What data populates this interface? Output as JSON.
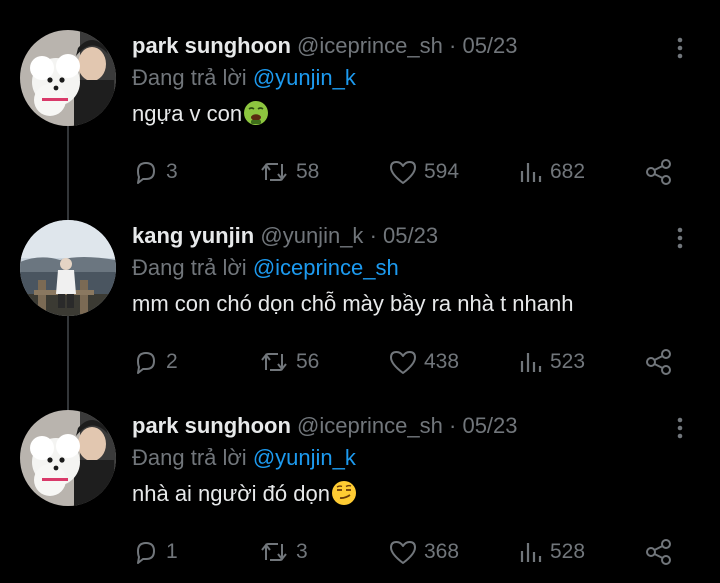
{
  "tweets": [
    {
      "name": "park sunghoon",
      "handle": "@iceprince_sh",
      "separator": "·",
      "date": "05/23",
      "reply_prefix": "Đang trả lời",
      "reply_to": "@yunjin_k",
      "text": "ngựa v con",
      "emoji": "nauseated-face",
      "replies": "3",
      "retweets": "58",
      "likes": "594",
      "views": "682"
    },
    {
      "name": "kang yunjin",
      "handle": "@yunjin_k",
      "separator": "·",
      "date": "05/23",
      "reply_prefix": "Đang trả lời",
      "reply_to": "@iceprince_sh",
      "text": "mm con chó dọn chỗ mày bầy ra nhà t nhanh",
      "emoji": "",
      "replies": "2",
      "retweets": "56",
      "likes": "438",
      "views": "523"
    },
    {
      "name": "park sunghoon",
      "handle": "@iceprince_sh",
      "separator": "·",
      "date": "05/23",
      "reply_prefix": "Đang trả lời",
      "reply_to": "@yunjin_k",
      "text": "nhà ai người đó dọn",
      "emoji": "smirking-face",
      "replies": "1",
      "retweets": "3",
      "likes": "368",
      "views": "528"
    }
  ],
  "colors": {
    "background": "#000000",
    "text": "#e7e9ea",
    "muted": "#71767b",
    "mention": "#1d9bf0",
    "thread_line": "#333639"
  }
}
